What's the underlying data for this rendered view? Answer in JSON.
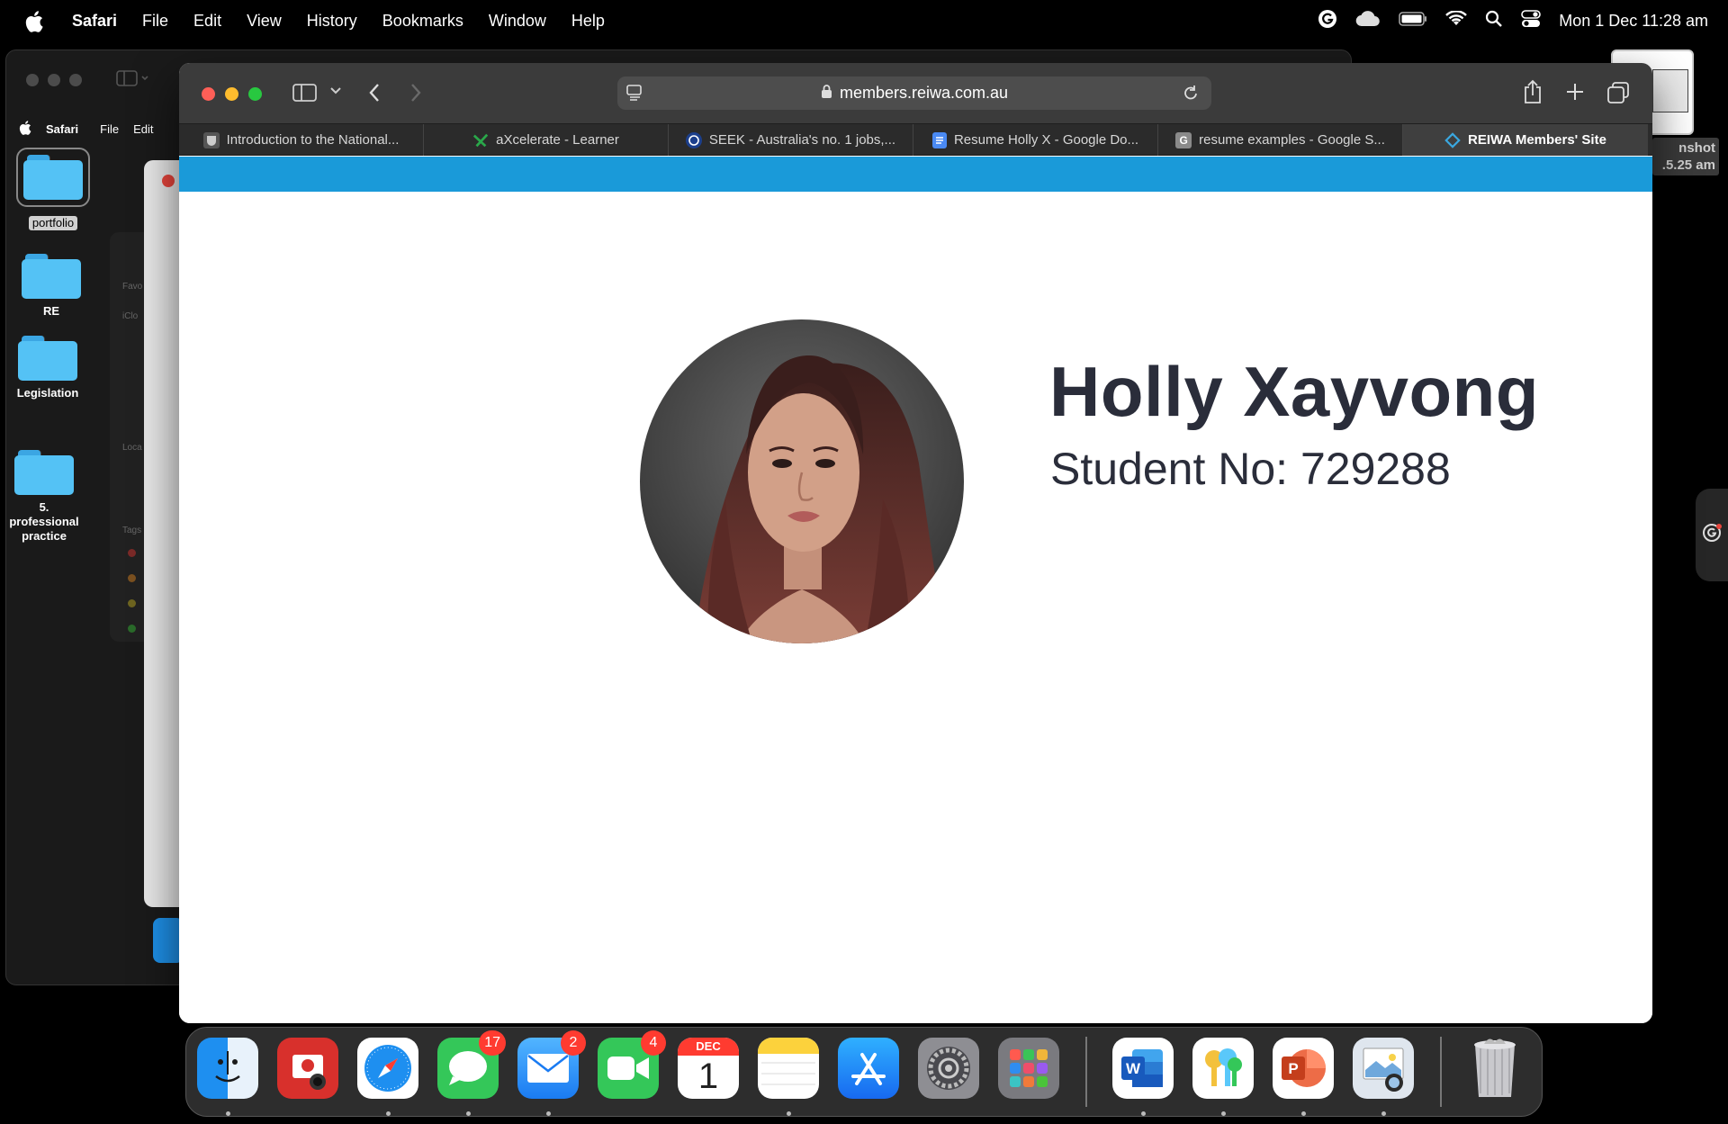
{
  "menubar": {
    "app_name": "Safari",
    "items": [
      "File",
      "Edit",
      "View",
      "History",
      "Bookmarks",
      "Window",
      "Help"
    ],
    "clock": "Mon 1 Dec  11:28 am"
  },
  "desktop": {
    "folders": [
      {
        "label": "portfolio"
      },
      {
        "label": "RE"
      },
      {
        "label": "Legislation"
      },
      {
        "label": "5. professional practice"
      }
    ],
    "screenshot_label": "nshot\n.5.25 am"
  },
  "background_window": {
    "app_name": "Safari",
    "menu_items": [
      "File",
      "Edit"
    ],
    "sidebar_labels": [
      "Favo",
      "iClo",
      "Loca",
      "Tags"
    ]
  },
  "safari": {
    "url": "members.reiwa.com.au",
    "tabs": [
      {
        "title": "Introduction to the National...",
        "icon": "crest-icon",
        "active": false
      },
      {
        "title": "aXcelerate - Learner",
        "icon": "x-check-icon",
        "active": false
      },
      {
        "title": "SEEK - Australia's no. 1 jobs,...",
        "icon": "seek-icon",
        "active": false
      },
      {
        "title": "Resume Holly X - Google Do...",
        "icon": "docs-icon",
        "active": false
      },
      {
        "title": "resume examples - Google S...",
        "icon": "google-g-icon",
        "active": false
      },
      {
        "title": "REIWA Members' Site",
        "icon": "reiwa-icon",
        "active": true
      }
    ]
  },
  "profile": {
    "name": "Holly Xayvong",
    "student_no": "Student No: 729288"
  },
  "dock": {
    "apps": [
      {
        "name": "Finder",
        "icon": "finder-icon",
        "running": true
      },
      {
        "name": "Photo Booth",
        "icon": "photo-booth-icon",
        "running": false
      },
      {
        "name": "Safari",
        "icon": "safari-icon",
        "running": true
      },
      {
        "name": "Messages",
        "icon": "messages-icon",
        "running": true,
        "badge": "17"
      },
      {
        "name": "Mail",
        "icon": "mail-icon",
        "running": true,
        "badge": "2"
      },
      {
        "name": "FaceTime",
        "icon": "facetime-icon",
        "running": false,
        "badge": "4"
      },
      {
        "name": "Calendar",
        "icon": "calendar-icon",
        "running": false,
        "month": "DEC",
        "day": "1"
      },
      {
        "name": "Notes",
        "icon": "notes-icon",
        "running": true
      },
      {
        "name": "App Store",
        "icon": "app-store-icon",
        "running": false
      },
      {
        "name": "System Settings",
        "icon": "settings-icon",
        "running": false
      },
      {
        "name": "Launchpad",
        "icon": "launchpad-icon",
        "running": false
      },
      {
        "name": "Microsoft Word",
        "icon": "word-icon",
        "running": true
      },
      {
        "name": "Passwords",
        "icon": "passwords-icon",
        "running": true
      },
      {
        "name": "Microsoft PowerPoint",
        "icon": "powerpoint-icon",
        "running": true
      },
      {
        "name": "Preview",
        "icon": "preview-icon",
        "running": true
      },
      {
        "name": "Trash",
        "icon": "trash-icon",
        "running": false
      }
    ]
  },
  "colors": {
    "reiwa_blue": "#1a9ad9",
    "name_text": "#2a2d3a",
    "badge_red": "#ff3b30"
  }
}
